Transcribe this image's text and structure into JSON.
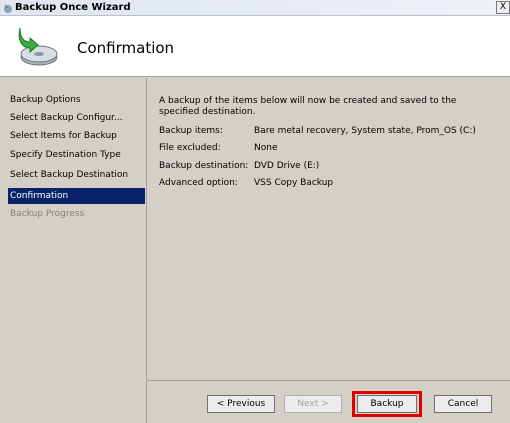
{
  "window": {
    "title": "Backup Once Wizard",
    "close_glyph": "X"
  },
  "header": {
    "title": "Confirmation",
    "icon": "backup-disk-icon"
  },
  "sidebar": {
    "steps": [
      {
        "label": "Backup Options",
        "state": "done"
      },
      {
        "label": "Select Backup Configur...",
        "state": "done"
      },
      {
        "label": "Select Items for Backup",
        "state": "done"
      },
      {
        "label": "Specify Destination Type",
        "state": "done"
      },
      {
        "label": "Select Backup Destination",
        "state": "done"
      },
      {
        "label": "Confirmation",
        "state": "active"
      },
      {
        "label": "Backup Progress",
        "state": "disabled"
      }
    ]
  },
  "content": {
    "intro": "A backup of the items below will now be created and saved to the specified destination.",
    "rows": [
      {
        "label": "Backup items:",
        "value": "Bare metal recovery, System state, Prom_OS (C:)"
      },
      {
        "label": "File excluded:",
        "value": "None"
      },
      {
        "label": "Backup destination:",
        "value": "DVD Drive (E:)"
      },
      {
        "label": "Advanced option:",
        "value": "VSS Copy Backup"
      }
    ]
  },
  "footer": {
    "previous_label": "< Previous",
    "next_label": "Next >",
    "backup_label": "Backup",
    "cancel_label": "Cancel"
  },
  "colors": {
    "active_step_bg": "#0a246a",
    "highlight_border": "#e00000"
  }
}
